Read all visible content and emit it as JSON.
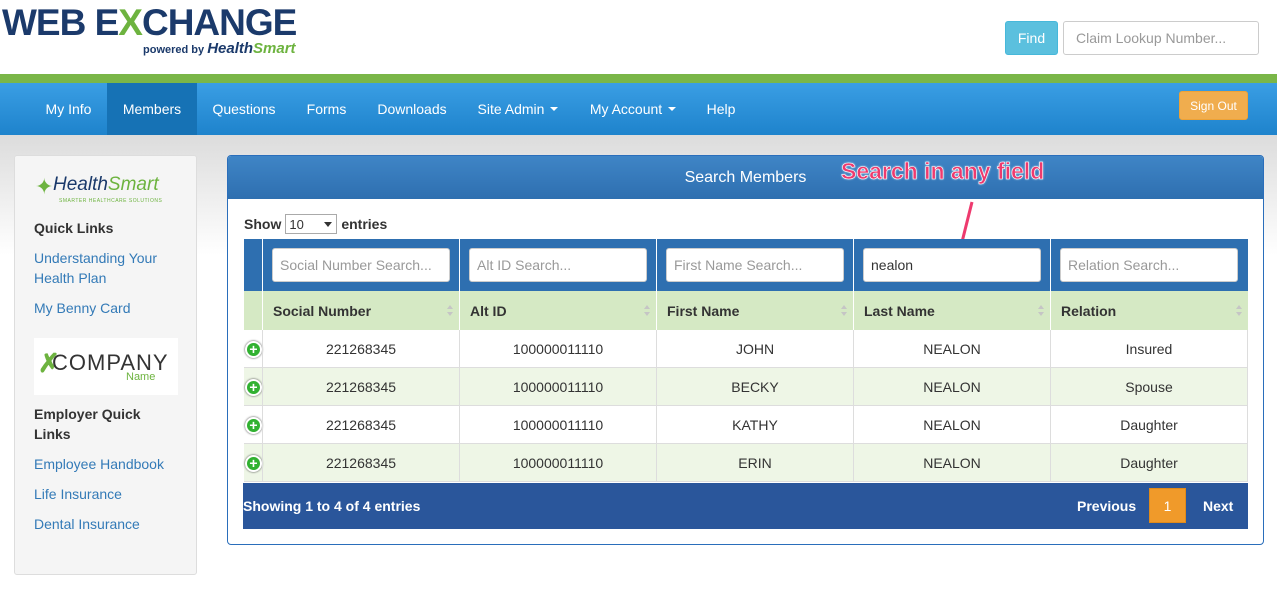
{
  "header": {
    "logo_web": "WEB E",
    "logo_x": "X",
    "logo_change": "CHANGE",
    "logo_powered": "powered by",
    "logo_health": "Health",
    "logo_smart": "Smart",
    "find_label": "Find",
    "claim_placeholder": "Claim Lookup Number..."
  },
  "nav": {
    "items": [
      "My Info",
      "Members",
      "Questions",
      "Forms",
      "Downloads",
      "Site Admin",
      "My Account",
      "Help"
    ],
    "active": "Members",
    "signout_label": "Sign Out"
  },
  "sidebar": {
    "hs_health": "Health",
    "hs_smart": "Smart",
    "hs_tagline": "SMARTER HEALTHCARE SOLUTIONS",
    "quick_links_title": "Quick Links",
    "quick_links": [
      "Understanding Your",
      "Health Plan",
      "My Benny Card"
    ],
    "company_word": "COMPANY",
    "company_name": "Name",
    "employer_title_1": "Employer Quick",
    "employer_title_2": "Links",
    "employer_links": [
      "Employee Handbook",
      "Life Insurance",
      "Dental Insurance"
    ]
  },
  "panel": {
    "title": "Search Members",
    "annotation": "Search in any field",
    "show_label": "Show",
    "entries_label": "entries",
    "page_size": "10",
    "filters": [
      {
        "placeholder": "Social Number Search...",
        "value": ""
      },
      {
        "placeholder": "Alt ID Search...",
        "value": ""
      },
      {
        "placeholder": "First Name Search...",
        "value": ""
      },
      {
        "placeholder": "",
        "value": "nealon"
      },
      {
        "placeholder": "Relation Search...",
        "value": ""
      }
    ],
    "columns": [
      "Social Number",
      "Alt ID",
      "First Name",
      "Last Name",
      "Relation"
    ],
    "rows": [
      [
        "221268345",
        "100000011110",
        "JOHN",
        "NEALON",
        "Insured"
      ],
      [
        "221268345",
        "100000011110",
        "BECKY",
        "NEALON",
        "Spouse"
      ],
      [
        "221268345",
        "100000011110",
        "KATHY",
        "NEALON",
        "Daughter"
      ],
      [
        "221268345",
        "100000011110",
        "ERIN",
        "NEALON",
        "Daughter"
      ]
    ],
    "footer_info": "Showing 1 to 4 of 4 entries",
    "prev_label": "Previous",
    "current_page": "1",
    "next_label": "Next"
  },
  "colors": {
    "nav_blue": "#1e83cc",
    "brand_green": "#7ab648",
    "signout_orange": "#f0ad4e",
    "annotation_pink": "#ee3a6e",
    "row_alt": "#eef6e6"
  }
}
